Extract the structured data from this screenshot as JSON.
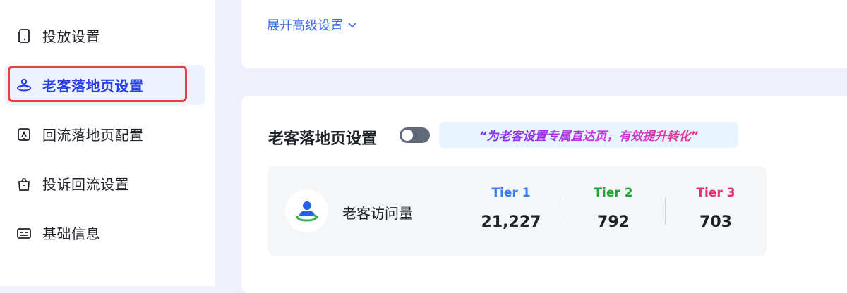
{
  "sidebar": {
    "items": [
      {
        "label": "投放设置",
        "icon": "tablet-icon"
      },
      {
        "label": "老客落地页设置",
        "icon": "user-orbit-icon",
        "active": true
      },
      {
        "label": "回流落地页配置",
        "icon": "return-flow-icon"
      },
      {
        "label": "投诉回流设置",
        "icon": "basket-icon"
      },
      {
        "label": "基础信息",
        "icon": "id-card-icon"
      }
    ]
  },
  "top_card": {
    "expand_label": "展开高级设置"
  },
  "section": {
    "title": "老客落地页设置",
    "toggle_on": false,
    "slogan": "“为老客设置专属直达页，有效提升转化”"
  },
  "stats": {
    "metric_label": "老客访问量",
    "tiers": [
      {
        "name": "Tier 1",
        "value": "21,227",
        "color": "#3b7ef0"
      },
      {
        "name": "Tier 2",
        "value": "792",
        "color": "#1ea832"
      },
      {
        "name": "Tier 3",
        "value": "703",
        "color": "#e8296d"
      }
    ]
  },
  "colors": {
    "accent": "#2a3fe8",
    "highlight": "#e8413b",
    "link": "#3b6df2"
  }
}
